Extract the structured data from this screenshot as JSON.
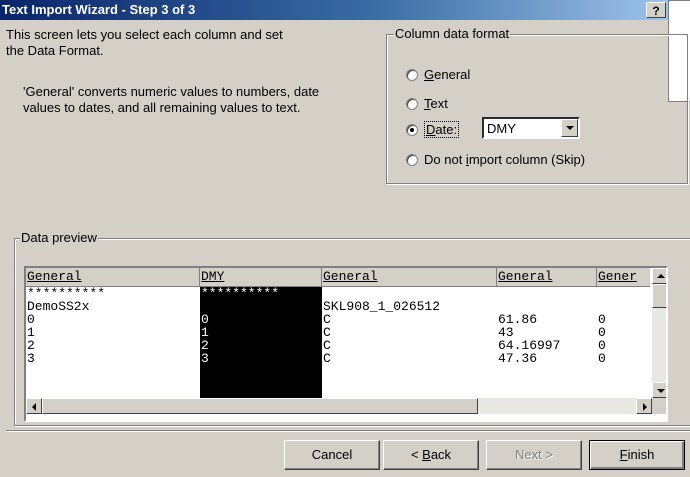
{
  "window": {
    "title": "Text Import Wizard - Step 3 of 3",
    "help_label": "?"
  },
  "description": {
    "line1": "This screen lets you select each column and set\nthe Data Format.",
    "line2": "'General' converts numeric values to numbers, date\nvalues to dates, and all remaining values to text."
  },
  "column_format": {
    "legend": "Column data format",
    "options": [
      {
        "label": "General",
        "accel": "G",
        "rest": "eneral",
        "checked": false
      },
      {
        "label": "Text",
        "accel": "T",
        "rest": "ext",
        "checked": false
      },
      {
        "label": "Date:",
        "accel": "D",
        "rest": "ate:",
        "checked": true
      },
      {
        "label": "Do not import column (Skip)",
        "pre": "Do not ",
        "accel": "i",
        "rest": "mport column (Skip)",
        "checked": false
      }
    ],
    "date_format": "DMY"
  },
  "preview": {
    "legend": "Data preview",
    "headers": [
      "General",
      "DMY",
      "General",
      "General",
      "Gener"
    ],
    "rows": [
      [
        "**********",
        "**********",
        "",
        "",
        ""
      ],
      [
        "DemoSS2x",
        "",
        "SKL908_1_026512",
        "",
        ""
      ],
      [
        "0",
        "0",
        "C",
        "61.86",
        "0"
      ],
      [
        "1",
        "1",
        "C",
        "43",
        "0"
      ],
      [
        "2",
        "2",
        "C",
        "64.16997",
        "0"
      ],
      [
        "3",
        "3",
        "C",
        "47.36",
        "0"
      ]
    ]
  },
  "buttons": {
    "cancel": "Cancel",
    "back": {
      "pre": "< ",
      "accel": "B",
      "rest": "ack"
    },
    "next": "Next >",
    "finish": {
      "accel": "F",
      "rest": "inish"
    }
  },
  "colors": {
    "title_start": "#0a246a",
    "title_end": "#a6caf0",
    "face": "#d4d0c8"
  }
}
